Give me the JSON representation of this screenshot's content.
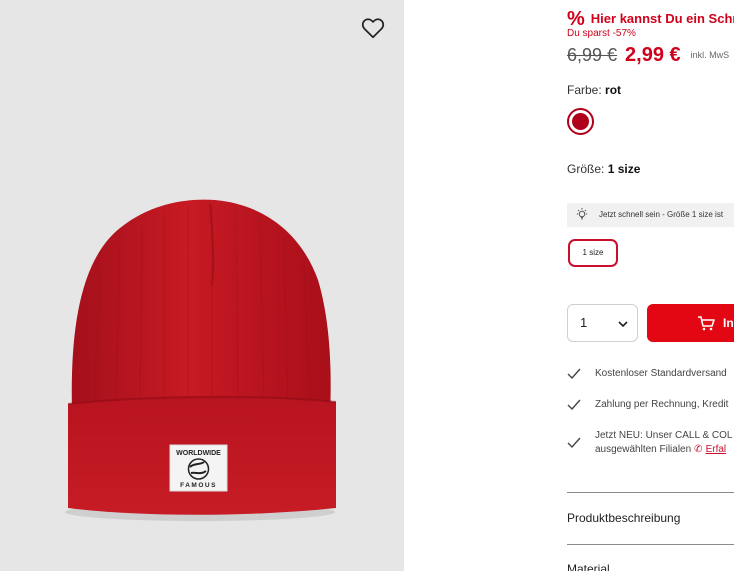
{
  "gallery": {
    "background": "#e6e6e6",
    "wishlist_icon": "heart-outline-icon",
    "image_alt": "Red knitted beanie with woven label",
    "label_line1": "WORLDWIDE",
    "label_line2": "FAMOUS"
  },
  "promo": {
    "icon": "%",
    "text": "Hier kannst Du ein Schnäp",
    "savings": "Du sparst -57%"
  },
  "price": {
    "old": "6,99 €",
    "new": "2,99 €",
    "vat": "inkl. MwS"
  },
  "color": {
    "label": "Farbe:",
    "value": "rot",
    "swatch_hex": "#b0001a"
  },
  "size": {
    "label": "Größe:",
    "value": "1 size",
    "hint_icon": "lightbulb-icon",
    "hint": "Jetzt schnell sein - Größe 1 size ist",
    "chip": "1 size"
  },
  "purchase": {
    "quantity": "1",
    "cart_icon": "cart-icon",
    "cart_label": "In"
  },
  "usps": [
    {
      "icon": "check-icon",
      "text": "Kostenloser Standardversand"
    },
    {
      "icon": "check-icon",
      "text": "Zahlung per Rechnung, Kredit"
    },
    {
      "icon": "check-icon",
      "text": "Jetzt NEU: Unser CALL & COL",
      "text2": "ausgewählten Filialen",
      "phone_icon": "phone-icon",
      "link": "Erfal"
    }
  ],
  "accordion": {
    "description": "Produktbeschreibung",
    "material": "Material"
  },
  "colors": {
    "accent": "#e30613",
    "promo_red": "#d0021b"
  }
}
